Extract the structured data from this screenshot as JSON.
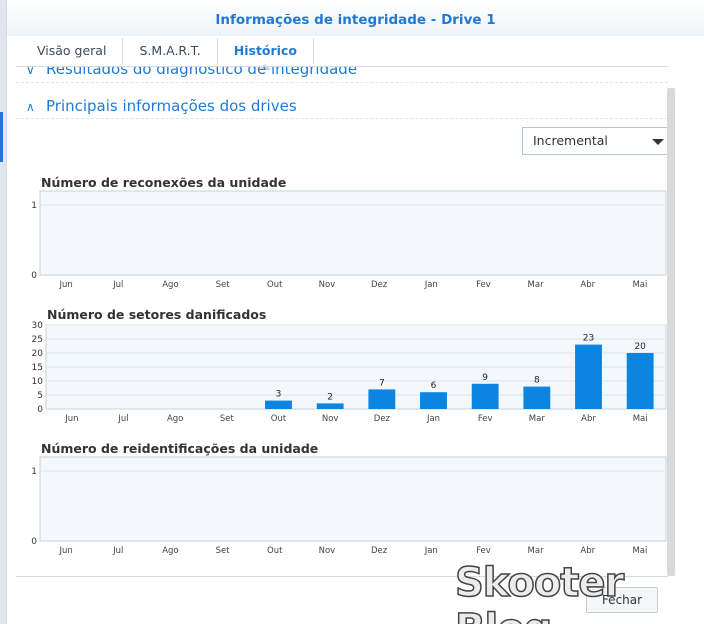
{
  "window": {
    "title": "Informações de integridade - Drive 1"
  },
  "tabs": [
    {
      "label": "Visão geral"
    },
    {
      "label": "S.M.A.R.T."
    },
    {
      "label": "Histórico",
      "active": true
    }
  ],
  "sections": {
    "diagnostic": "Resultados do diagnóstico de integridade",
    "drive_info": "Principais informações dos drives"
  },
  "mode_select": {
    "value": "Incremental"
  },
  "footer": {
    "close_label": "Fechar"
  },
  "watermark": "Skooter Blog",
  "colors": {
    "accent": "#1f7ad6",
    "bar": "#0c85e0",
    "plot_bg": "#f4f8fc"
  },
  "chart_data": [
    {
      "type": "bar",
      "title": "Número de reconexões da unidade",
      "categories": [
        "Jun",
        "Jul",
        "Ago",
        "Set",
        "Out",
        "Nov",
        "Dez",
        "Jan",
        "Fev",
        "Mar",
        "Abr",
        "Mai"
      ],
      "values": [
        0,
        0,
        0,
        0,
        0,
        0,
        0,
        0,
        0,
        0,
        0,
        0
      ],
      "show_labels": false,
      "yticks": [
        0,
        1
      ],
      "ylim": [
        0,
        1.2
      ]
    },
    {
      "type": "bar",
      "title": "Número de setores danificados",
      "categories": [
        "Jun",
        "Jul",
        "Ago",
        "Set",
        "Out",
        "Nov",
        "Dez",
        "Jan",
        "Fev",
        "Mar",
        "Abr",
        "Mai"
      ],
      "values": [
        0,
        0,
        0,
        0,
        3,
        2,
        7,
        6,
        9,
        8,
        23,
        20
      ],
      "show_labels": true,
      "yticks": [
        0,
        5,
        10,
        15,
        20,
        25,
        30
      ],
      "ylim": [
        0,
        30
      ]
    },
    {
      "type": "bar",
      "title": "Número de reidentificações da unidade",
      "categories": [
        "Jun",
        "Jul",
        "Ago",
        "Set",
        "Out",
        "Nov",
        "Dez",
        "Jan",
        "Fev",
        "Mar",
        "Abr",
        "Mai"
      ],
      "values": [
        0,
        0,
        0,
        0,
        0,
        0,
        0,
        0,
        0,
        0,
        0,
        0
      ],
      "show_labels": false,
      "yticks": [
        0,
        1
      ],
      "ylim": [
        0,
        1.2
      ]
    }
  ]
}
